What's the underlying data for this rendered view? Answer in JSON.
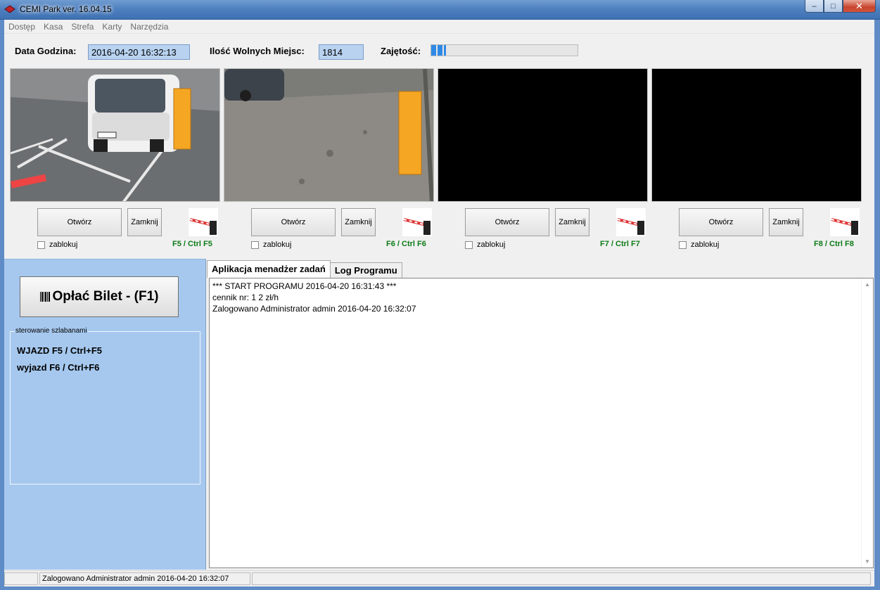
{
  "window": {
    "title": "CEMI Park ver.  16.04.15",
    "minimize": "–",
    "maximize": "□",
    "close": "✕"
  },
  "menu": [
    "Dostęp",
    "Kasa",
    "Strefa",
    "Karty",
    "Narzędzia"
  ],
  "info": {
    "datetime_label": "Data Godzina:",
    "datetime_value": "2016-04-20 16:32:13",
    "free_label": "Ilość Wolnych Miejsc:",
    "free_value": "1814",
    "occupancy_label": "Zajętość:",
    "occupancy_level": 0.1
  },
  "cameras": [
    {
      "open": "Otwórz",
      "close": "Zamknij",
      "lock": "zablokuj",
      "hotkey": "F5 / Ctrl F5",
      "feed": "camera-feed-entry"
    },
    {
      "open": "Otwórz",
      "close": "Zamknij",
      "lock": "zablokuj",
      "hotkey": "F6 / Ctrl F6",
      "feed": "camera-feed-exit"
    },
    {
      "open": "Otwórz",
      "close": "Zamknij",
      "lock": "zablokuj",
      "hotkey": "F7 / Ctrl F7",
      "feed": "camera-feed-empty"
    },
    {
      "open": "Otwórz",
      "close": "Zamknij",
      "lock": "zablokuj",
      "hotkey": "F8 / Ctrl F8",
      "feed": "camera-feed-empty"
    }
  ],
  "pay_button": "Opłać Bilet - (F1)",
  "barrier_control": {
    "legend": "sterowanie szlabanami",
    "entry": "WJAZD F5 / Ctrl+F5",
    "exit": "wyjazd F6 / Ctrl+F6"
  },
  "tabs": [
    "Aplikacja menadżer zadań",
    "Log Programu"
  ],
  "log_lines": [
    "*** START PROGRAMU  2016-04-20 16:31:43 ***",
    "cennik nr: 1 2 zł/h",
    "Zalogowano Administrator admin 2016-04-20 16:32:07"
  ],
  "status_text": "Zalogowano Administrator admin 2016-04-20 16:32:07",
  "colors": {
    "accent_green": "#0b7a16",
    "panel_blue": "#a6c8ee",
    "barrier_orange": "#f5a623"
  }
}
